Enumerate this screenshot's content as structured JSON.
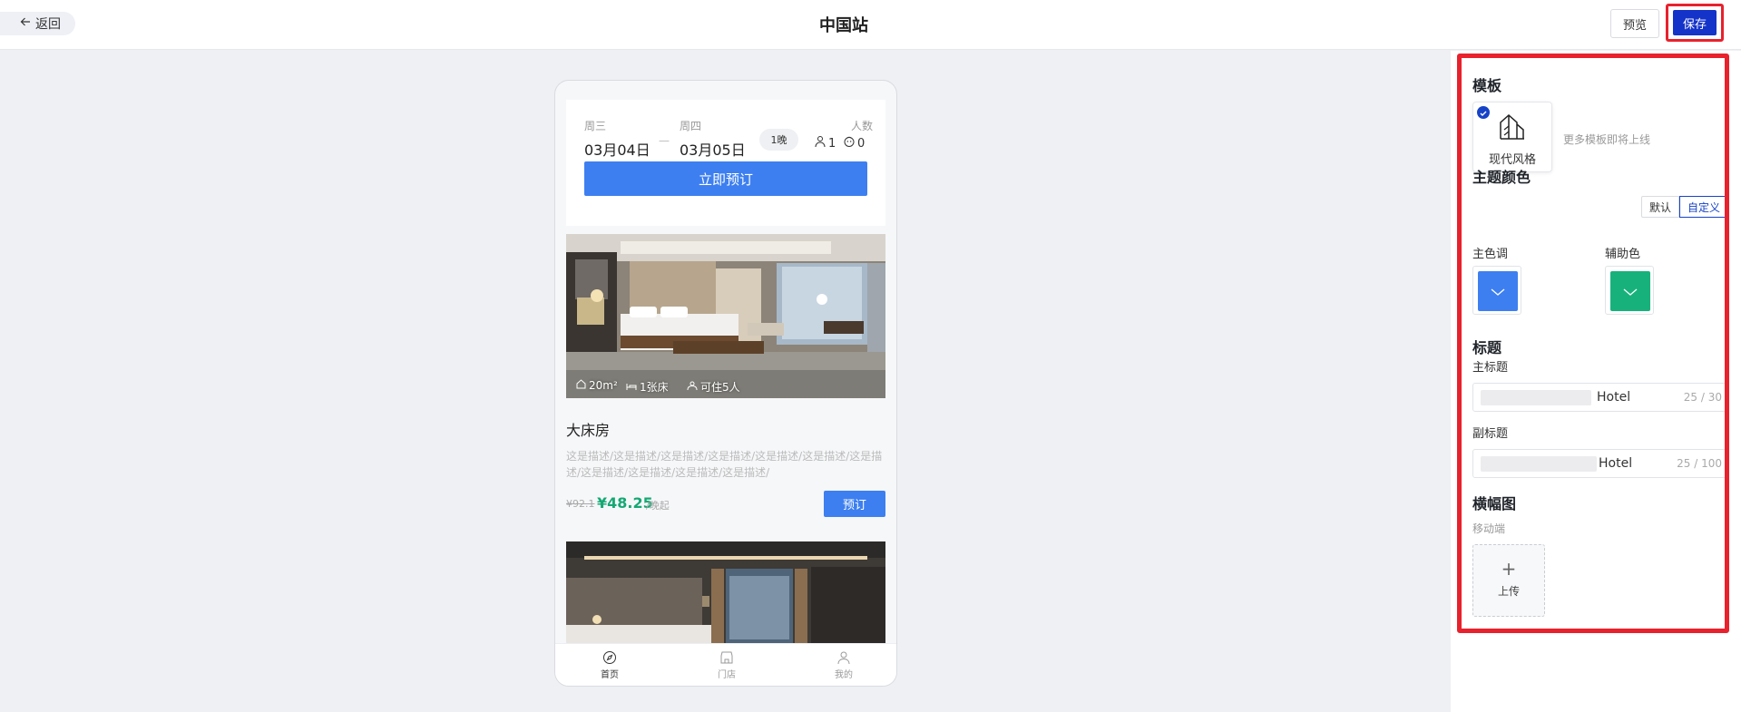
{
  "header": {
    "back_label": "返回",
    "title": "中国站",
    "preview_label": "预览",
    "save_label": "保存"
  },
  "phone": {
    "booking": {
      "checkin_day": "周三",
      "checkin_date": "03月04日",
      "dash": "—",
      "checkout_day": "周四",
      "checkout_date": "03月05日",
      "nights": "1晚",
      "people_label": "人数",
      "adults": "1",
      "children": "0",
      "book_now": "立即预订"
    },
    "room": {
      "area": "20m²",
      "beds": "1张床",
      "capacity": "可住5人",
      "name": "大床房",
      "description": "这是描述/这是描述/这是描述/这是描述/这是描述/这是描述/这是描述/这是描述/这是描述/这是描述/这是描述/",
      "old_price": "¥92.1",
      "price": "¥48.25",
      "per_night": "/晚起",
      "book_label": "预订"
    },
    "nav": [
      {
        "label": "首页",
        "icon": "compass-icon",
        "active": true
      },
      {
        "label": "门店",
        "icon": "store-icon",
        "active": false
      },
      {
        "label": "我的",
        "icon": "user-icon",
        "active": false
      }
    ]
  },
  "settings": {
    "template": {
      "heading": "模板",
      "selected": "现代风格",
      "more_note": "更多模板即将上线"
    },
    "theme": {
      "heading": "主题颜色",
      "mode_default": "默认",
      "mode_custom": "自定义",
      "primary_label": "主色调",
      "primary_color": "#3d7ff0",
      "secondary_label": "辅助色",
      "secondary_color": "#17b27c"
    },
    "title": {
      "heading": "标题",
      "main_label": "主标题",
      "main_value": "Hotel",
      "main_count": "25 / 30",
      "sub_label": "副标题",
      "sub_value": "Hotel",
      "sub_count": "25 / 100"
    },
    "banner": {
      "heading": "横幅图",
      "mobile_label": "移动端",
      "upload_plus": "+",
      "upload_label": "上传"
    }
  }
}
